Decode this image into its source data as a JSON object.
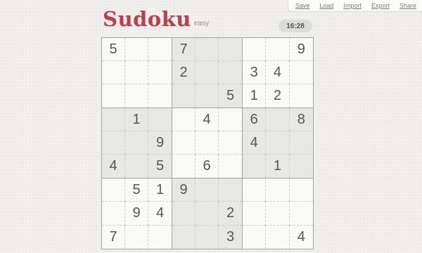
{
  "menu": {
    "items": [
      "Save",
      "Load",
      "Import",
      "Export",
      "Share"
    ]
  },
  "header": {
    "title": "Sudoku",
    "difficulty": "easy",
    "timer": "16:28"
  },
  "colors": {
    "brand": "#b5434e",
    "shaded_box": "#e7e7e5",
    "digit": "#555555"
  },
  "shaded_boxes": [
    1,
    3,
    5,
    7
  ],
  "board": [
    [
      "5",
      "",
      "",
      "7",
      "",
      "",
      "",
      "",
      "9"
    ],
    [
      "",
      "",
      "",
      "2",
      "",
      "",
      "3",
      "4",
      ""
    ],
    [
      "",
      "",
      "",
      "",
      "",
      "5",
      "1",
      "2",
      ""
    ],
    [
      "",
      "1",
      "",
      "",
      "4",
      "",
      "6",
      "",
      "8"
    ],
    [
      "",
      "",
      "9",
      "",
      "",
      "",
      "4",
      "",
      ""
    ],
    [
      "4",
      "",
      "5",
      "",
      "6",
      "",
      "",
      "1",
      ""
    ],
    [
      "",
      "5",
      "1",
      "9",
      "",
      "",
      "",
      "",
      ""
    ],
    [
      "",
      "9",
      "4",
      "",
      "",
      "2",
      "",
      "",
      ""
    ],
    [
      "7",
      "",
      "",
      "",
      "",
      "3",
      "",
      "",
      "4"
    ]
  ]
}
